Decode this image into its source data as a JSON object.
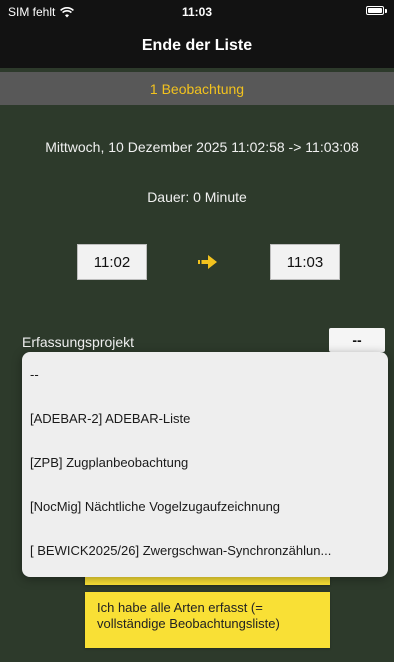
{
  "status": {
    "carrier": "SIM fehlt",
    "time": "11:03",
    "icons": {
      "wifi": "wifi-icon",
      "battery": "battery-icon"
    }
  },
  "nav": {
    "title": "Ende der Liste"
  },
  "observation": {
    "count_label": "1 Beobachtung"
  },
  "session": {
    "date_range": "Mittwoch, 10 Dezember 2025 11:02:58 -> 11:03:08",
    "duration": "Dauer: 0 Minute",
    "start_time": "11:02",
    "end_time": "11:03",
    "arrow_icon": "arrow-right-icon"
  },
  "project": {
    "label": "Erfassungsprojekt",
    "selected_value": "--",
    "options": [
      {
        "label": "--"
      },
      {
        "label": "[ADEBAR-2] ADEBAR-Liste"
      },
      {
        "label": "[ZPB] Zugplanbeobachtung"
      },
      {
        "label": "[NocMig] Nächtliche Vogelzugaufzeichnung"
      },
      {
        "label": "[ BEWICK2025/26] Zwergschwan-Synchronzählun..."
      }
    ]
  },
  "actions": {
    "complete_list_label": "Ich habe alle Arten erfasst (= vollständige Beobachtungsliste)"
  },
  "colors": {
    "background": "#2d3a2b",
    "bar_dark": "#121212",
    "obs_bar": "#585858",
    "accent": "#f2c21e",
    "button_yellow": "#f9e035",
    "dropdown_bg": "#eeeeee"
  }
}
